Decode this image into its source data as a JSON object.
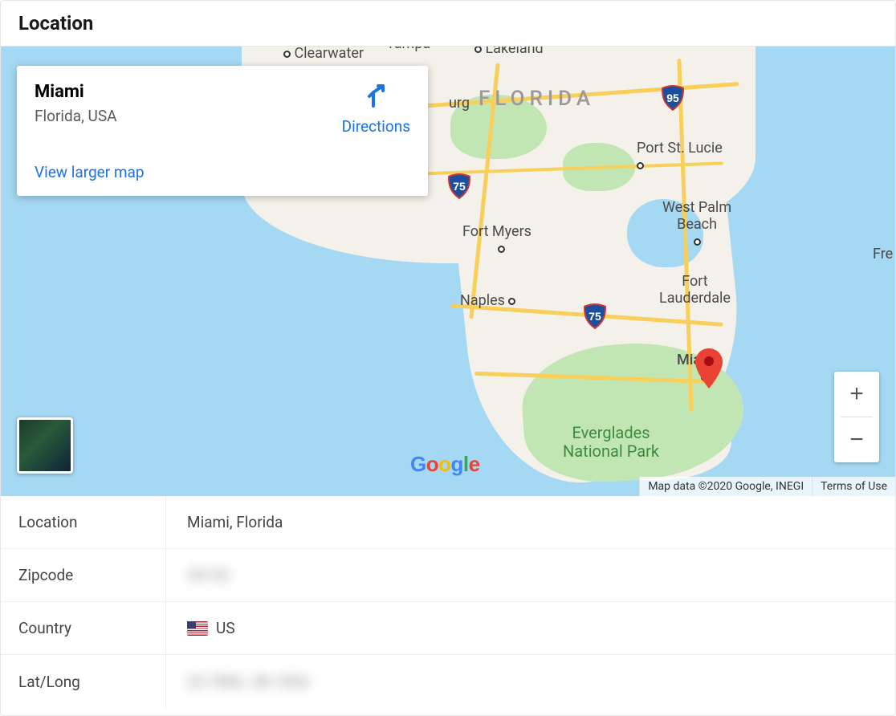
{
  "header": {
    "title": "Location"
  },
  "map": {
    "bubble": {
      "title": "Miami",
      "subtitle": "Florida, USA",
      "directions_label": "Directions",
      "larger_label": "View larger map"
    },
    "state_label": "FLORIDA",
    "cities": {
      "clearwater": "Clearwater",
      "tampa": "Tampa",
      "lakeland": "Lakeland",
      "petersburg_suffix": "urg",
      "port_st_lucie": "Port St. Lucie",
      "west_palm_line1": "West Palm",
      "west_palm_line2": "Beach",
      "fort_myers": "Fort Myers",
      "naples": "Naples",
      "fort_lauderdale_line1": "Fort",
      "fort_lauderdale_line2": "Lauderdale",
      "miami": "Miami",
      "fre_partial": "Fre"
    },
    "park": {
      "line1": "Everglades",
      "line2": "National Park"
    },
    "shields": {
      "i95": "95",
      "i75a": "75",
      "i75b": "75"
    },
    "attribution": {
      "data": "Map data ©2020 Google, INEGI",
      "terms": "Terms of Use"
    },
    "logo": "Google",
    "zoom": {
      "in": "+",
      "out": "−"
    }
  },
  "table": {
    "rows": [
      {
        "key": "Location",
        "value": "Miami, Florida",
        "type": "text"
      },
      {
        "key": "Zipcode",
        "value": "33132",
        "type": "blurred"
      },
      {
        "key": "Country",
        "value": "US",
        "type": "flag"
      },
      {
        "key": "Lat/Long",
        "value": "25.7806, -80.1826",
        "type": "blurred"
      }
    ]
  }
}
